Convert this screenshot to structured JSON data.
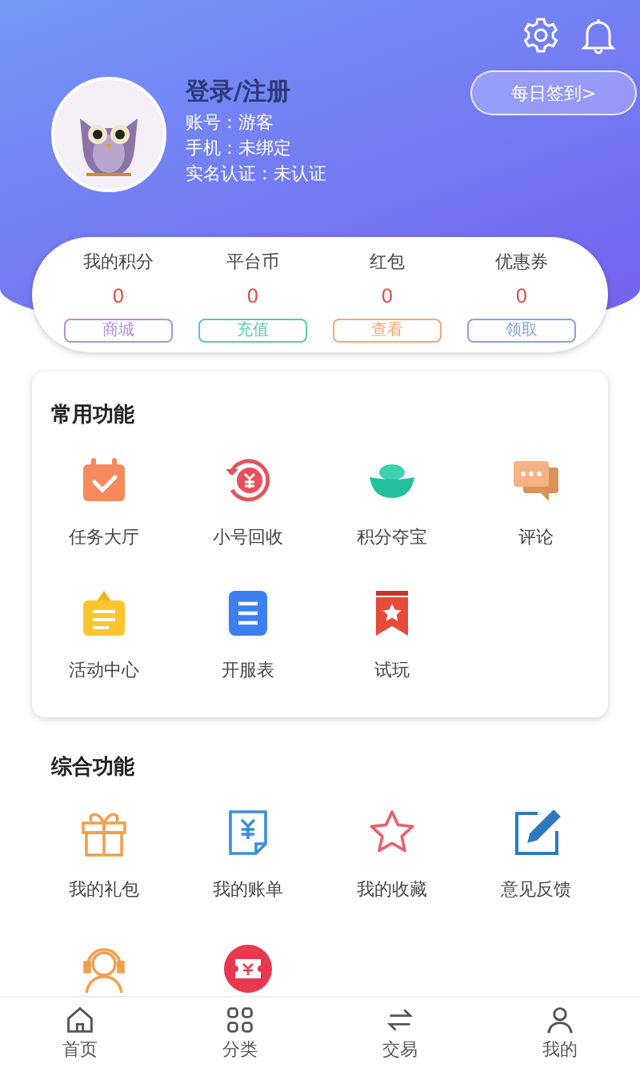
{
  "header": {
    "title": "登录/注册",
    "account": "账号：游客",
    "phone": "手机：未绑定",
    "verify": "实名认证：未认证",
    "sign_in_button": "每日签到>"
  },
  "stats": [
    {
      "label": "我的积分",
      "value": "0",
      "action": "商城",
      "color": "#b48ee0"
    },
    {
      "label": "平台币",
      "value": "0",
      "action": "充值",
      "color": "#5cc9b0"
    },
    {
      "label": "红包",
      "value": "0",
      "action": "查看",
      "color": "#f0a880"
    },
    {
      "label": "优惠券",
      "value": "0",
      "action": "领取",
      "color": "#8aa4d8"
    }
  ],
  "common_functions": {
    "title": "常用功能",
    "items": [
      {
        "kind": "labeled",
        "label": "任务大厅"
      },
      {
        "kind": "labeled",
        "label": "小号回收"
      },
      {
        "kind": "labeled",
        "label": "积分夺宝"
      },
      {
        "kind": "labeled",
        "label": "评论"
      },
      {
        "kind": "labeled",
        "label": "活动中心"
      },
      {
        "kind": "labeled",
        "label": "开服表"
      },
      {
        "kind": "labeled",
        "label": "试玩"
      }
    ]
  },
  "general_functions": {
    "title": "综合功能",
    "items": [
      {
        "kind": "labeled",
        "label": "我的礼包"
      },
      {
        "kind": "labeled",
        "label": "我的账单"
      },
      {
        "kind": "labeled",
        "label": "我的收藏"
      },
      {
        "kind": "labeled",
        "label": "意见反馈"
      },
      {
        "kind": "icon"
      },
      {
        "kind": "icon"
      }
    ]
  },
  "bottom_nav": [
    {
      "label": "首页"
    },
    {
      "label": "分类"
    },
    {
      "label": "交易"
    },
    {
      "label": "我的"
    }
  ]
}
